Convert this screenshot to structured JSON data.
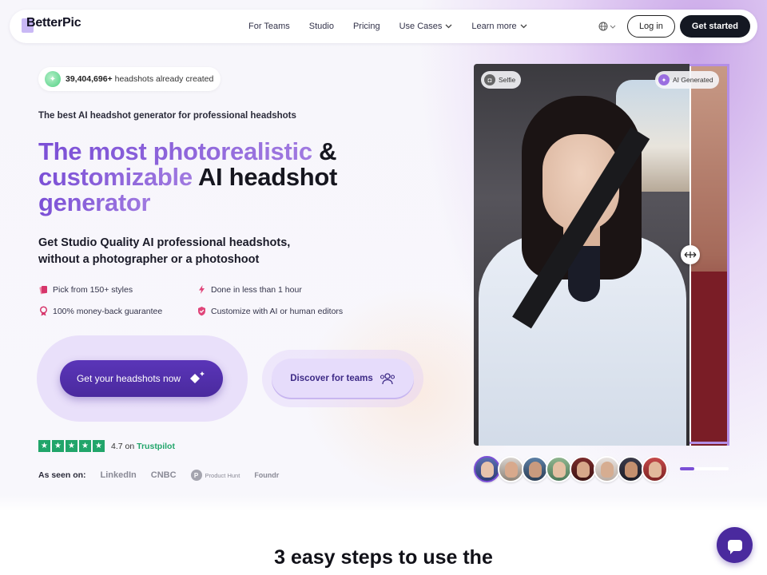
{
  "nav": {
    "logo": "BetterPic",
    "links": [
      {
        "label": "For Teams",
        "dropdown": false
      },
      {
        "label": "Studio",
        "dropdown": false
      },
      {
        "label": "Pricing",
        "dropdown": false
      },
      {
        "label": "Use Cases",
        "dropdown": true
      },
      {
        "label": "Learn more",
        "dropdown": true
      }
    ],
    "login": "Log in",
    "get_started": "Get started"
  },
  "hero": {
    "count_number": "39,404,696+",
    "count_suffix": "headshots already created",
    "tagline": "The best AI headshot generator for professional headshots",
    "headline_accent_1": "The most photorealistic",
    "headline_amp": "&",
    "headline_accent_2": "customizable",
    "headline_dark": "AI headshot",
    "headline_accent_3": "generator",
    "subhead": "Get Studio Quality AI professional headshots, without a photographer or a photoshoot",
    "features": [
      "Pick from 150+ styles",
      "Done in less than 1 hour",
      "100% money-back guarantee",
      "Customize with AI or human editors"
    ],
    "cta_primary": "Get your headshots now",
    "cta_secondary": "Discover for teams",
    "rating": "4.7",
    "rating_on": "on",
    "rating_brand": "Trustpilot",
    "seen_on_label": "As seen on:",
    "media": [
      "LinkedIn",
      "CNBC",
      "Product Hunt",
      "Foundr"
    ]
  },
  "comparison": {
    "left_label": "Selfie",
    "right_label": "AI Generated",
    "progress": 0.3
  },
  "steps_title": "3 easy steps to use the",
  "colors": {
    "brand": "#4a2a9e",
    "accent": "#7b4fd6",
    "trustpilot": "#21a56a"
  }
}
